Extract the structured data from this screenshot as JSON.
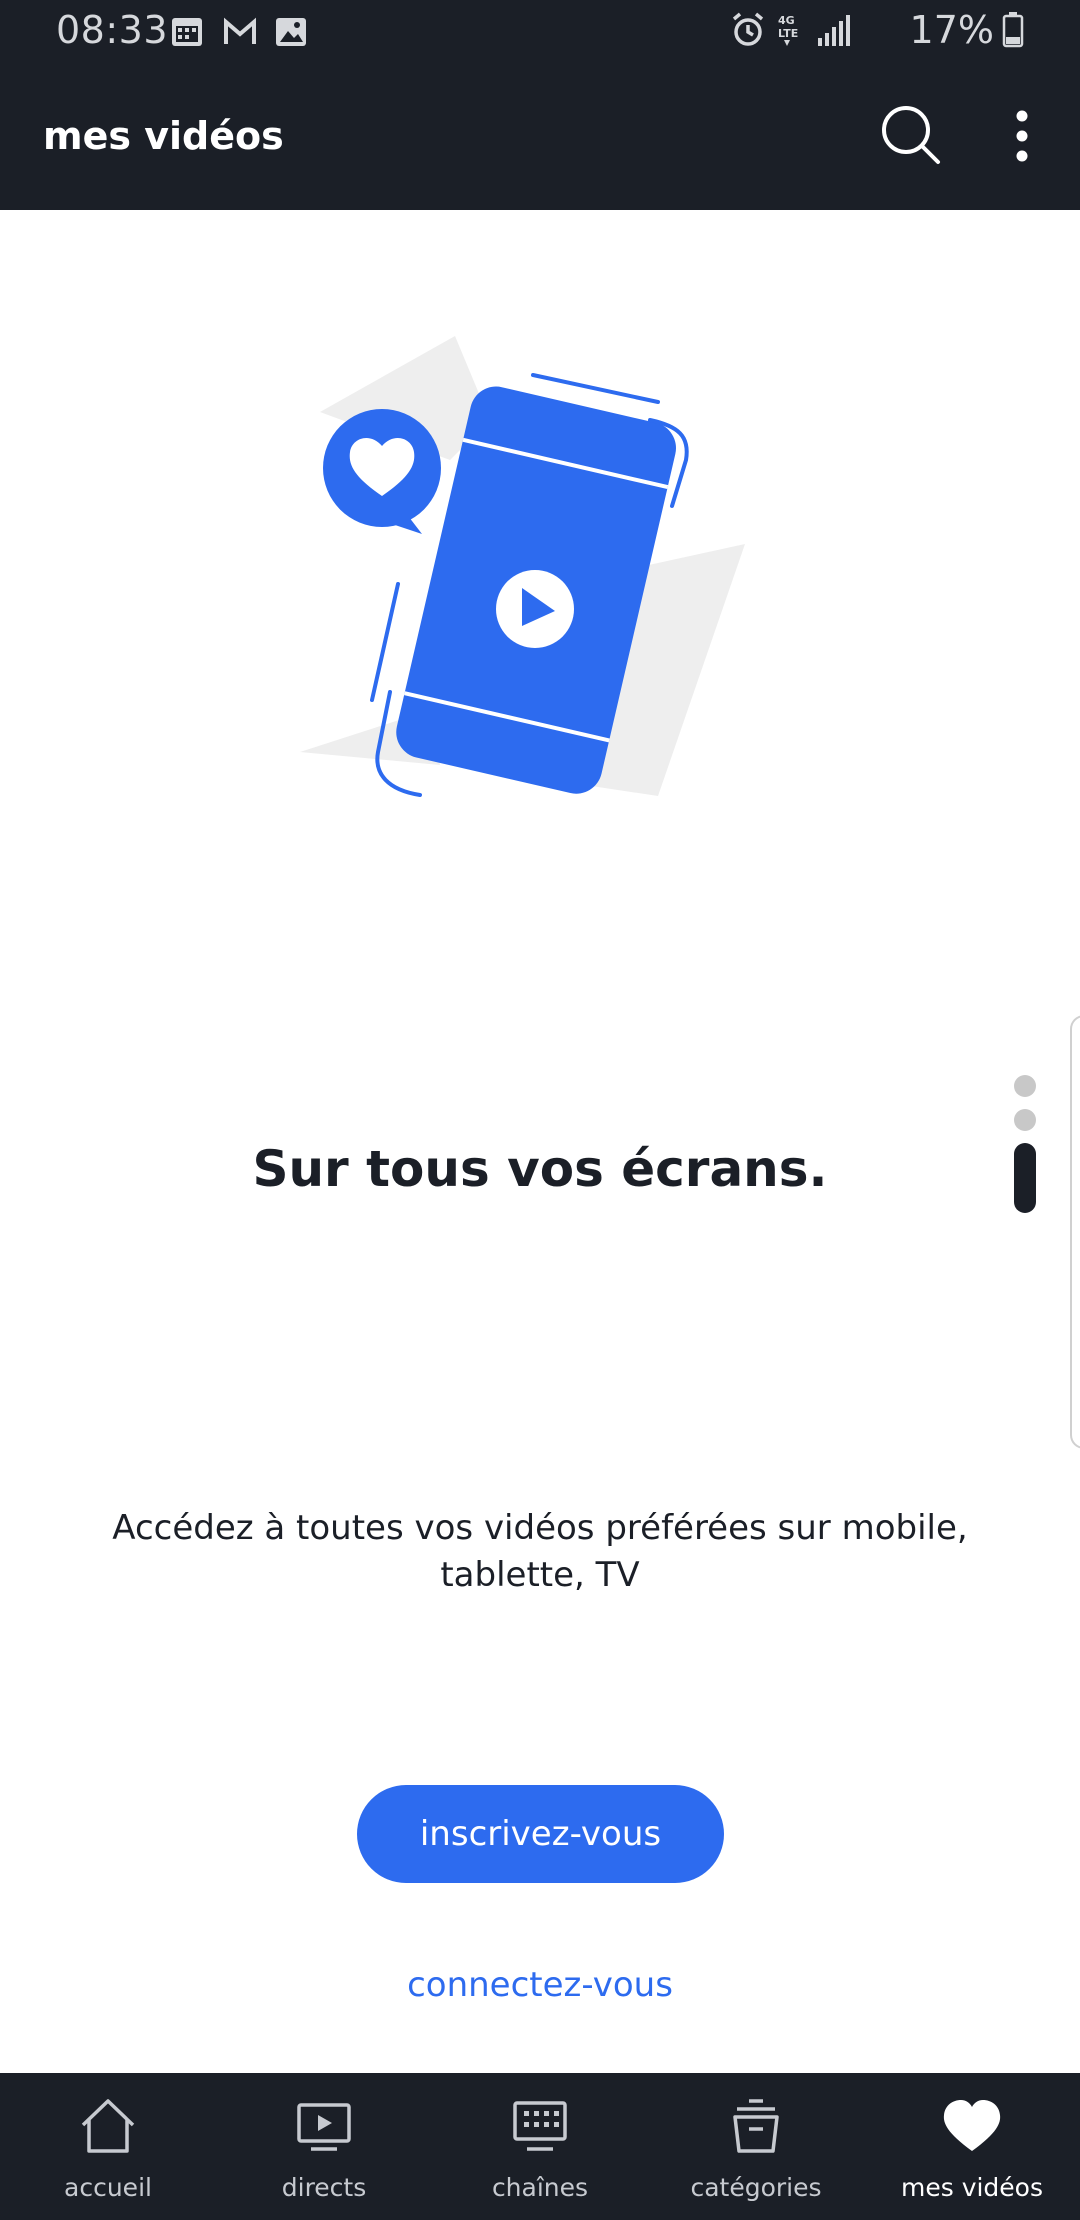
{
  "status_bar": {
    "time": "08:33",
    "battery": "17%"
  },
  "app_bar": {
    "title": "mes vidéos"
  },
  "content": {
    "headline": "Sur tous vos écrans.",
    "subtitle_line1": "Accédez à toutes vos vidéos préférées sur mobile,",
    "subtitle_line2": "tablette, TV",
    "signup_label": "inscrivez-vous",
    "login_label": "connectez-vous"
  },
  "pager": {
    "pages": 3,
    "current": 3
  },
  "bottom_nav": {
    "items": [
      {
        "label": "accueil",
        "icon": "home-icon"
      },
      {
        "label": "directs",
        "icon": "live-tv-icon"
      },
      {
        "label": "chaînes",
        "icon": "channels-icon"
      },
      {
        "label": "catégories",
        "icon": "categories-icon"
      },
      {
        "label": "mes vidéos",
        "icon": "heart-icon",
        "active": true
      }
    ]
  },
  "colors": {
    "accent": "#2d6bef",
    "dark": "#1b1f27"
  }
}
